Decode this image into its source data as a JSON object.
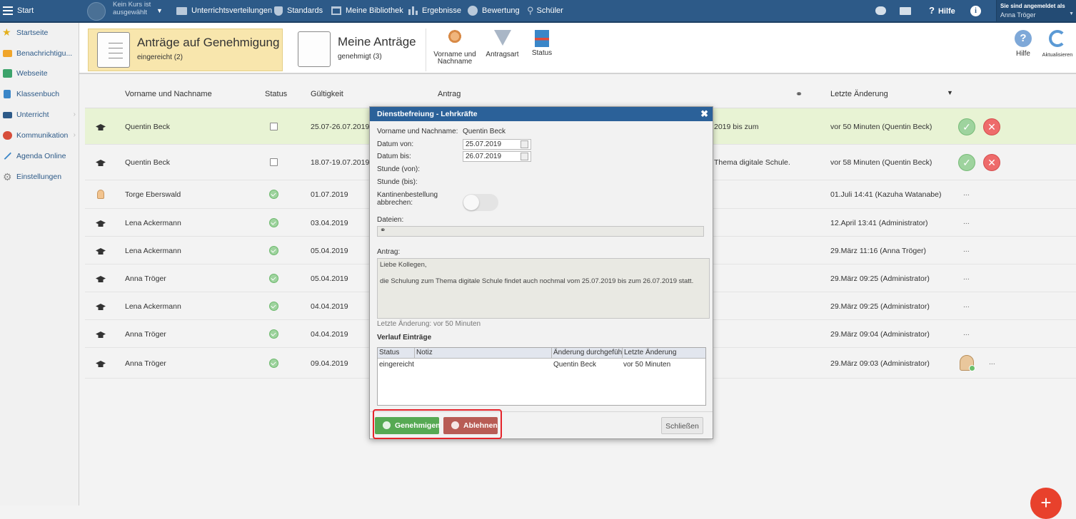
{
  "topbar": {
    "start": "Start",
    "course_line1": "Kein Kurs ist",
    "course_line2": "ausgewählt",
    "nav": [
      "Unterrichtsverteilungen",
      "Standards",
      "Meine Bibliothek",
      "Ergebnisse",
      "Bewertung",
      "Schüler"
    ],
    "help": "Hilfe",
    "logged_in_label": "Sie sind angemeldet als",
    "user": "Anna Tröger"
  },
  "sidebar": {
    "items": [
      {
        "label": "Startseite",
        "icon": "star-icon",
        "color": "#e4b01d"
      },
      {
        "label": "Benachrichtigu...",
        "icon": "envelope-icon",
        "color": "#f0a52a"
      },
      {
        "label": "Webseite",
        "icon": "home-icon",
        "color": "#3ca36b"
      },
      {
        "label": "Klassenbuch",
        "icon": "book-icon",
        "color": "#3a86c8"
      },
      {
        "label": "Unterricht",
        "icon": "teaching-icon",
        "color": "#2d5a88"
      },
      {
        "label": "Kommunikation",
        "icon": "chat-icon",
        "color": "#d74d3a"
      },
      {
        "label": "Agenda Online",
        "icon": "pen-icon",
        "color": "#3a86c8"
      },
      {
        "label": "Einstellungen",
        "icon": "gear-icon",
        "color": "#888888"
      }
    ]
  },
  "toolbar": {
    "tab1_title": "Anträge auf Genehmigung",
    "tab1_sub": "eingereicht (2)",
    "tab2_title": "Meine Anträge",
    "tab2_sub": "genehmigt (3)",
    "filter1_l1": "Vorname und",
    "filter1_l2": "Nachname",
    "filter2": "Antragsart",
    "filter3": "Status",
    "help": "Hilfe",
    "refresh": "Aktualisieren"
  },
  "table": {
    "headers": {
      "name": "Vorname und Nachname",
      "status": "Status",
      "validity": "Gültigkeit",
      "request": "Antrag",
      "changed": "Letzte Änderung"
    },
    "rows": [
      {
        "name": "Quentin Beck",
        "status": "pending",
        "validity": "25.07-26.07.2019",
        "request": "2019 bis zum",
        "changed": "vor 50 Minuten (Quentin Beck)"
      },
      {
        "name": "Quentin Beck",
        "status": "pending",
        "validity": "18.07-19.07.2019",
        "request": "Thema digitale Schule.",
        "changed": "vor 58 Minuten (Quentin Beck)"
      },
      {
        "name": "Torge Eberswald",
        "status": "approved",
        "validity": "01.07.2019",
        "request": "",
        "changed": "01.Juli 14:41 (Kazuha Watanabe)",
        "more": "..."
      },
      {
        "name": "Lena Ackermann",
        "status": "approved",
        "validity": "03.04.2019",
        "request": "",
        "changed": "12.April 13:41 (Administrator)",
        "more": "..."
      },
      {
        "name": "Lena Ackermann",
        "status": "approved",
        "validity": "05.04.2019",
        "request": "",
        "changed": "29.März 11:16 (Anna Tröger)",
        "more": "..."
      },
      {
        "name": "Anna Tröger",
        "status": "approved",
        "validity": "05.04.2019",
        "request": "",
        "changed": "29.März 09:25 (Administrator)",
        "more": "..."
      },
      {
        "name": "Lena Ackermann",
        "status": "approved",
        "validity": "04.04.2019",
        "request": "",
        "changed": "29.März 09:25 (Administrator)",
        "more": "..."
      },
      {
        "name": "Anna Tröger",
        "status": "approved",
        "validity": "04.04.2019",
        "request": "",
        "changed": "29.März 09:04 (Administrator)",
        "more": "..."
      },
      {
        "name": "Anna Tröger",
        "status": "approved",
        "validity": "09.04.2019",
        "request": "",
        "changed": "29.März 09:03 (Administrator)",
        "more": "..."
      }
    ]
  },
  "modal": {
    "title": "Dienstbefreiung - Lehrkräfte",
    "name_label": "Vorname und Nachname:",
    "name_value": "Quentin Beck",
    "from_label": "Datum von:",
    "from_value": "25.07.2019",
    "to_label": "Datum bis:",
    "to_value": "26.07.2019",
    "hour_from_label": "Stunde (von):",
    "hour_to_label": "Stunde (bis):",
    "canteen_label_1": "Kantinenbestellung",
    "canteen_label_2": "abbrechen:",
    "files_label": "Dateien:",
    "request_label": "Antrag:",
    "request_text": "Liebe Kollegen,\n\ndie Schulung zum Thema digitale Schule findet auch nochmal vom 25.07.2019 bis zum 26.07.2019 statt.",
    "last_change": "Letzte Änderung: vor 50 Minuten",
    "history_title": "Verlauf Einträge",
    "history_headers": [
      "Status",
      "Notiz",
      "Änderung durchgeführt",
      "Letzte Änderung"
    ],
    "history_row": [
      "eingereicht",
      "",
      "Quentin Beck",
      "vor 50 Minuten"
    ],
    "approve": "Genehmigen",
    "reject": "Ablehnen",
    "close": "Schließen"
  },
  "colors": {
    "topbar": "#2d5a88",
    "highlight_row": "#e8f3d4",
    "approve": "#56a953",
    "reject": "#b85c55",
    "active_tab": "#f8e6ad"
  }
}
